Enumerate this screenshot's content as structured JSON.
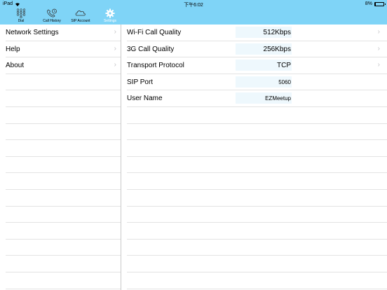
{
  "status_bar": {
    "device": "iPad",
    "time": "下午6:02",
    "battery_text": "8%",
    "battery_level": 0.08
  },
  "tabs": [
    {
      "label": "Dial",
      "icon": "keypad-icon"
    },
    {
      "label": "Call History",
      "icon": "call-history-icon"
    },
    {
      "label": "SIP Account",
      "icon": "cloud-icon"
    },
    {
      "label": "Settings",
      "icon": "gear-icon",
      "active": true
    }
  ],
  "sidebar": {
    "items": [
      {
        "label": "Network Settings"
      },
      {
        "label": "Help"
      },
      {
        "label": "About"
      }
    ]
  },
  "detail": {
    "rows": [
      {
        "label": "Wi-Fi Call Quality",
        "value": "512Kbps"
      },
      {
        "label": "3G Call Quality",
        "value": "256Kbps"
      },
      {
        "label": "Transport Protocol",
        "value": "TCP"
      },
      {
        "label": "SIP Port",
        "value": "5060"
      },
      {
        "label": "User Name",
        "value": "EZMeetup"
      }
    ]
  },
  "colors": {
    "header_bg": "#7fd4f7",
    "active_tab": "#ffffff",
    "value_field_bg": "#eef8fd",
    "chevron": "#c4c4c8"
  }
}
